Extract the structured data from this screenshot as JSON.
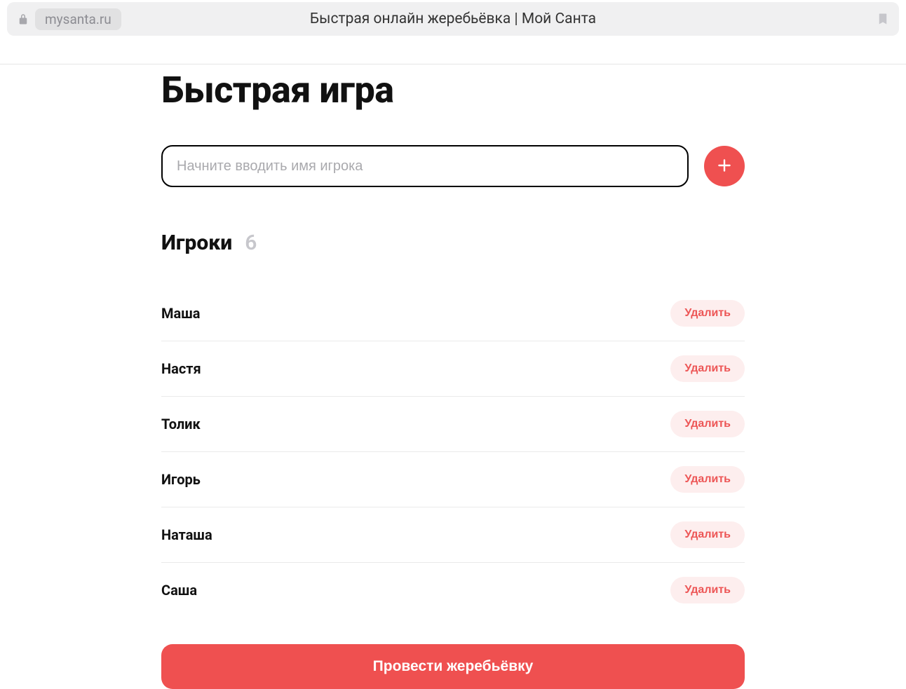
{
  "browser": {
    "domain": "mysanta.ru",
    "title": "Быстрая онлайн жеребьёвка | Мой Санта"
  },
  "page": {
    "heading": "Быстрая игра",
    "input_placeholder": "Начните вводить имя игрока",
    "players_label": "Игроки",
    "players_count": "6",
    "delete_label": "Удалить",
    "submit_label": "Провести жеребьёвку"
  },
  "players": [
    {
      "name": "Маша"
    },
    {
      "name": "Настя"
    },
    {
      "name": "Толик"
    },
    {
      "name": "Игорь"
    },
    {
      "name": "Наташа"
    },
    {
      "name": "Саша"
    }
  ]
}
